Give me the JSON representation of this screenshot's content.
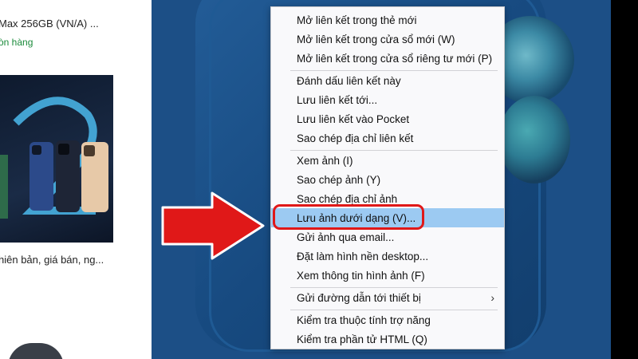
{
  "left_panel": {
    "product_title": "Max 256GB (VN/A) ...",
    "stock_status": "òn hàng",
    "product_caption": "hiên bản, giá bán, ng..."
  },
  "context_menu": {
    "items": [
      {
        "label": "Mở liên kết trong thẻ mới"
      },
      {
        "label": "Mở liên kết trong cửa sổ mới (W)"
      },
      {
        "label": "Mở liên kết trong cửa sổ riêng tư mới (P)"
      },
      {
        "label": "Đánh dấu liên kết này"
      },
      {
        "label": "Lưu liên kết tới..."
      },
      {
        "label": "Lưu liên kết vào Pocket"
      },
      {
        "label": "Sao chép địa chỉ liên kết"
      },
      {
        "label": "Xem ảnh (I)"
      },
      {
        "label": "Sao chép ảnh (Y)"
      },
      {
        "label": "Sao chép địa chỉ ảnh"
      },
      {
        "label": "Lưu ảnh dưới dạng (V)...",
        "highlighted": true
      },
      {
        "label": "Gửi ảnh qua email..."
      },
      {
        "label": "Đặt làm hình nền desktop..."
      },
      {
        "label": "Xem thông tin hình ảnh (F)"
      },
      {
        "label": "Gửi đường dẫn tới thiết bị",
        "submenu_glyph": "›"
      },
      {
        "label": "Kiểm tra thuộc tính trợ năng"
      },
      {
        "label": "Kiểm tra phần tử HTML (Q)"
      }
    ]
  },
  "annotation": {
    "arrow_color": "#e01818",
    "highlight_box_color": "#e01818",
    "arrow_icon": "arrow-right-icon"
  },
  "colors": {
    "menu_highlight": "#9ccaf2",
    "stock_green": "#1a8a3a",
    "phone_blue": "#1c4f86"
  }
}
